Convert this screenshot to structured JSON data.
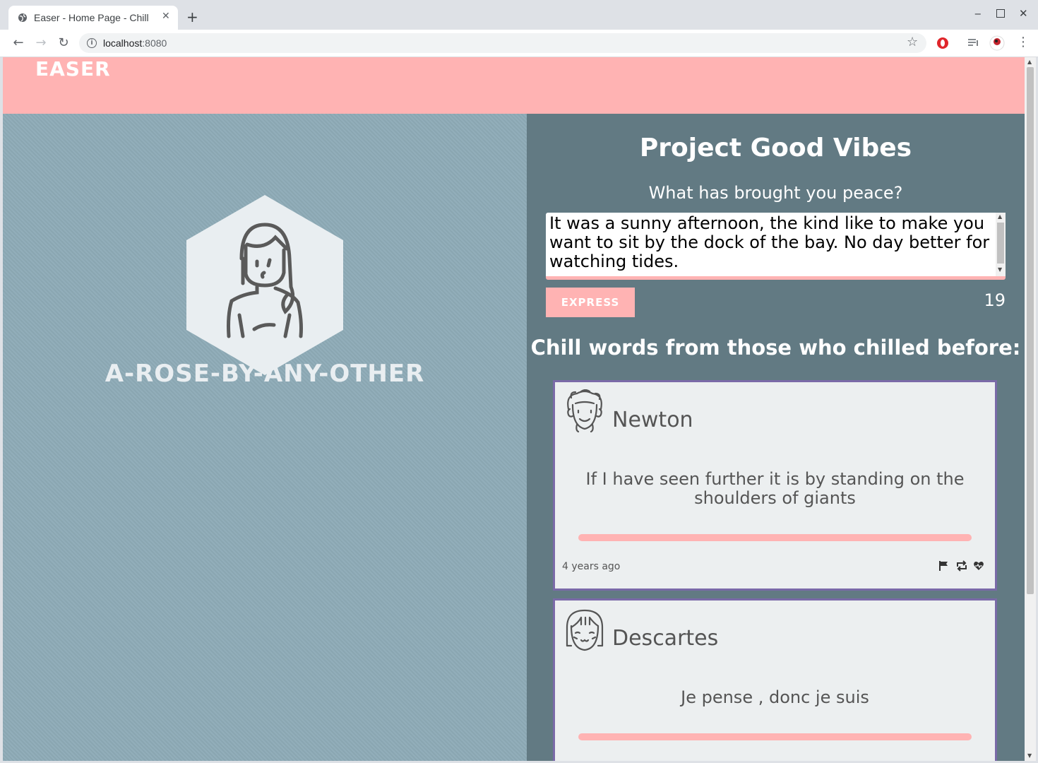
{
  "browser": {
    "tab_title": "Easer - Home Page - Chill",
    "url_host": "localhost",
    "url_port": ":8080"
  },
  "app": {
    "brand": "EASER",
    "username": "A-ROSE-BY-ANY-OTHER"
  },
  "composer": {
    "title": "Project Good Vibes",
    "prompt": "What has brought you peace?",
    "entry_text": "It was a sunny afternoon, the kind like to make you want to sit by the dock of the bay. No day better for watching tides.",
    "button_label": "EXPRESS",
    "count": "19"
  },
  "feed": {
    "heading": "Chill words from those who chilled before:",
    "posts": [
      {
        "author": "Newton",
        "quote": "If I have seen further it is by standing on the shoulders of giants",
        "time": "4 years ago"
      },
      {
        "author": "Descartes",
        "quote": "Je pense , donc je suis"
      }
    ]
  },
  "colors": {
    "header_pink": "#ffb3b3",
    "left_panel": "#8eabb7",
    "right_panel": "#627a83",
    "card_bg": "#eceff0",
    "card_border": "#7a6aa8"
  },
  "icons": [
    "globe-icon",
    "close-icon",
    "plus-icon",
    "back-icon",
    "forward-icon",
    "reload-icon",
    "info-icon",
    "star-icon",
    "flag-icon",
    "retweet-icon",
    "heart-icon"
  ]
}
